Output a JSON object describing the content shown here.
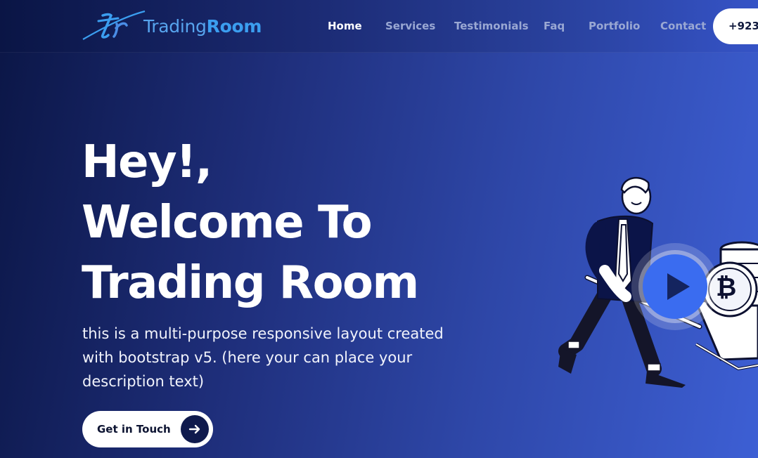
{
  "brand": {
    "name_part1": "Trading",
    "name_part2": "Room",
    "logo_monogram": "tr",
    "colors": {
      "light": "#57a4ee",
      "bold": "#3b9ef0"
    }
  },
  "nav": {
    "items": [
      {
        "label": "Home",
        "active": true
      },
      {
        "label": "Services",
        "active": false
      },
      {
        "label": "Testimonials",
        "active": false
      },
      {
        "label": "Faq",
        "active": false
      },
      {
        "label": "Portfolio",
        "active": false
      },
      {
        "label": "Contact",
        "active": false
      }
    ],
    "phone_label": "+923"
  },
  "hero": {
    "title_line1": "Hey!,",
    "title_line2": "Welcome To",
    "title_line3": "Trading Room",
    "description": "this is a multi-purpose responsive layout created with bootstrap v5. (here your can place your description text)",
    "cta_label": "Get in Touch",
    "cta_icon": "arrow-right-icon"
  },
  "illustration": {
    "subject": "man-pushing-wheelbarrow-of-coins",
    "coin_symbol": "bitcoin-icon",
    "play_icon": "play-icon"
  },
  "colors": {
    "bg_dark": "#0b1646",
    "bg_light": "#3d5fd4",
    "accent_blue": "#3a6cf0",
    "nav_text": "#9aa8d3",
    "cta_circle": "#0f1a4d"
  }
}
